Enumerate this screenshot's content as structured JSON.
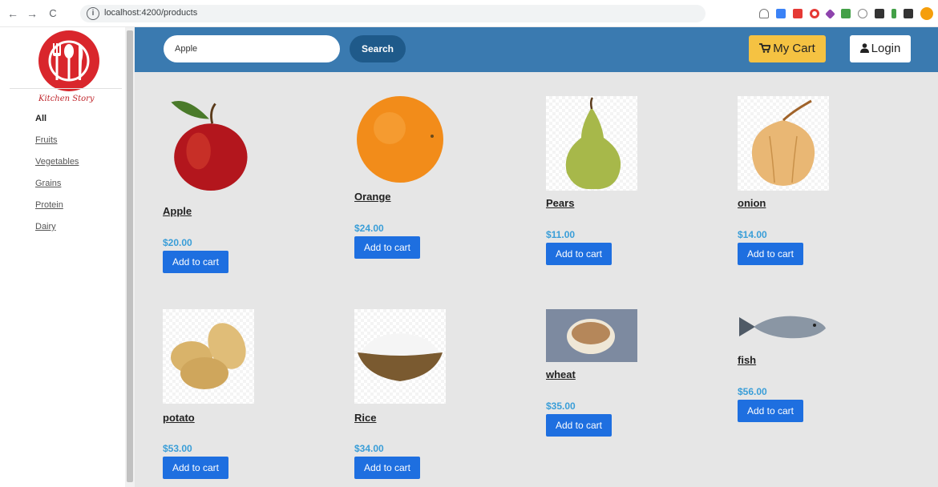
{
  "browser": {
    "url": "localhost:4200/products",
    "back_icon": "←",
    "forward_icon": "→",
    "reload_icon": "C",
    "info_icon": "i",
    "extensions": [
      "star-icon",
      "speaker-icon",
      "briefcase-icon",
      "opera-icon",
      "vpn-icon",
      "extension-icon",
      "globe-icon",
      "document-icon",
      "pin-icon",
      "puzzle-icon",
      "profile-icon"
    ],
    "extension_colors": [
      "#888888",
      "#3b82f6",
      "#e53935",
      "#e53935",
      "#8e44ad",
      "#43a047",
      "#888888",
      "#333333",
      "#43a047",
      "#333333",
      "#f59e0b"
    ]
  },
  "sidebar": {
    "logo_text": "Kitchen Story",
    "categories": [
      "All",
      "Fruits",
      "Vegetables",
      "Grains",
      "Protein",
      "Dairy"
    ]
  },
  "header": {
    "search_value": "Apple",
    "search_button": "Search",
    "cart_label": "My Cart",
    "cart_icon": "🛒",
    "login_label": "Login",
    "login_icon": "👤"
  },
  "colors": {
    "navbar": "#3a7ab0",
    "cart_button": "#f5c242",
    "add_button": "#1e6fe0",
    "price": "#3a9ed8",
    "logo_red": "#d9262c"
  },
  "products": [
    {
      "name": "Apple",
      "price": "$20.00",
      "button": "Add to cart",
      "icon": "apple-image"
    },
    {
      "name": "Orange",
      "price": "$24.00",
      "button": "Add to cart",
      "icon": "orange-image"
    },
    {
      "name": "Pears",
      "price": "$11.00",
      "button": "Add to cart",
      "icon": "pear-image"
    },
    {
      "name": "onion",
      "price": "$14.00",
      "button": "Add to cart",
      "icon": "onion-image"
    },
    {
      "name": "potato",
      "price": "$53.00",
      "button": "Add to cart",
      "icon": "potato-image"
    },
    {
      "name": "Rice",
      "price": "$34.00",
      "button": "Add to cart",
      "icon": "rice-image"
    },
    {
      "name": "wheat",
      "price": "$35.00",
      "button": "Add to cart",
      "icon": "wheat-image"
    },
    {
      "name": "fish",
      "price": "$56.00",
      "button": "Add to cart",
      "icon": "fish-image"
    }
  ]
}
